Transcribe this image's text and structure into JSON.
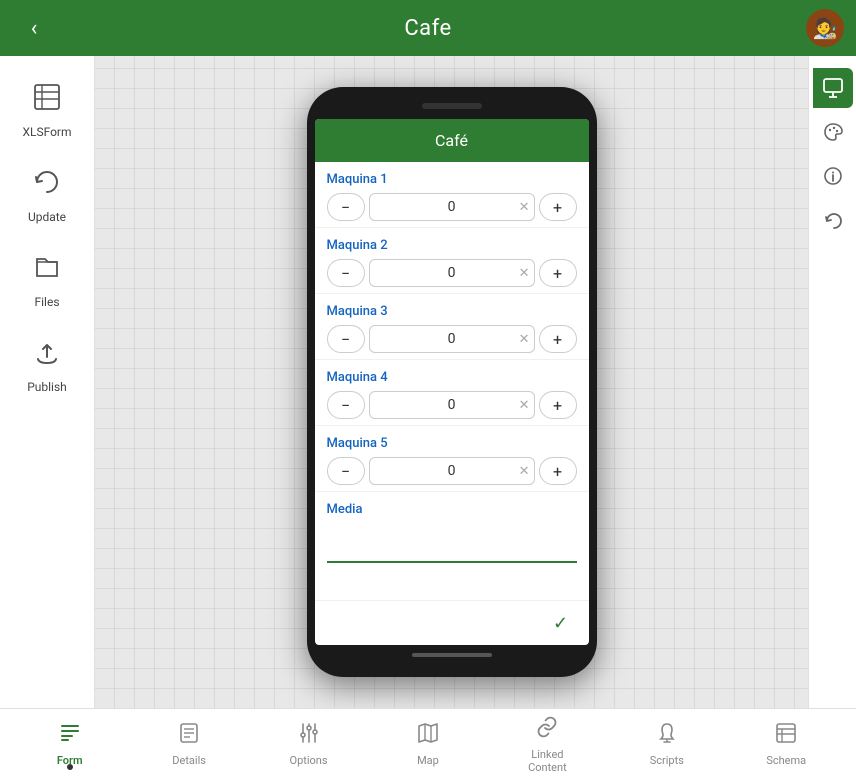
{
  "header": {
    "title": "Cafe",
    "back_label": "‹",
    "avatar_emoji": "🧑‍🎨"
  },
  "sidebar": {
    "items": [
      {
        "id": "xlsform",
        "label": "XLSForm",
        "icon": "📊"
      },
      {
        "id": "update",
        "label": "Update",
        "icon": "🔄"
      },
      {
        "id": "files",
        "label": "Files",
        "icon": "📁"
      },
      {
        "id": "publish",
        "label": "Publish",
        "icon": "☁️"
      }
    ]
  },
  "right_tools": [
    {
      "id": "monitor",
      "icon": "🖥",
      "active": true
    },
    {
      "id": "palette",
      "icon": "🎨",
      "active": false
    },
    {
      "id": "info",
      "icon": "ℹ",
      "active": false
    },
    {
      "id": "undo",
      "icon": "↺",
      "active": false
    }
  ],
  "phone": {
    "app_title": "Café",
    "machines": [
      {
        "label": "Maquina 1",
        "value": "0"
      },
      {
        "label": "Maquina 2",
        "value": "0"
      },
      {
        "label": "Maquina 3",
        "value": "0"
      },
      {
        "label": "Maquina 4",
        "value": "0"
      },
      {
        "label": "Maquina 5",
        "value": "0"
      }
    ],
    "media_label": "Media",
    "media_placeholder": ""
  },
  "tabs": [
    {
      "id": "form",
      "label": "Form",
      "icon": "≡",
      "active": true,
      "dot": true
    },
    {
      "id": "details",
      "label": "Details",
      "icon": "📋",
      "active": false,
      "dot": false
    },
    {
      "id": "options",
      "label": "Options",
      "icon": "⚙",
      "active": false,
      "dot": false
    },
    {
      "id": "map",
      "label": "Map",
      "icon": "🗺",
      "active": false,
      "dot": false
    },
    {
      "id": "linked",
      "label": "Linked\nContent",
      "icon": "🔗",
      "active": false,
      "dot": false
    },
    {
      "id": "scripts",
      "label": "Scripts",
      "icon": "🦷",
      "active": false,
      "dot": false
    },
    {
      "id": "schema",
      "label": "Schema",
      "icon": "📅",
      "active": false,
      "dot": false
    }
  ]
}
